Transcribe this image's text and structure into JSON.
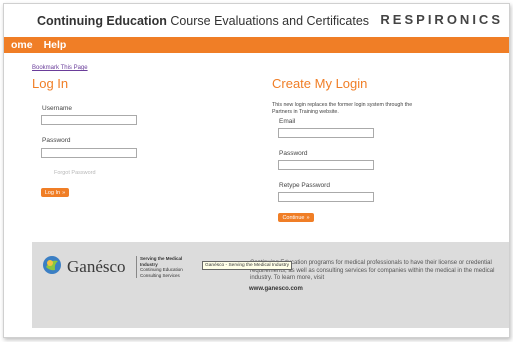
{
  "header": {
    "title_strong": "Continuing Education",
    "title_rest": " Course Evaluations and Certificates",
    "brand": "RESPIRONICS"
  },
  "nav": {
    "items": [
      "ome",
      "Help"
    ]
  },
  "bookmark_label": "Bookmark This Page",
  "login": {
    "heading": "Log In",
    "username_label": "Username",
    "username_value": "",
    "password_label": "Password",
    "password_value": "",
    "forgot_label": "Forgot Password",
    "button_label": "Log In"
  },
  "create": {
    "heading": "Create My Login",
    "description": "This new login replaces the former login system through the Partners in Training website.",
    "email_label": "Email",
    "email_value": "",
    "password_label": "Password",
    "password_value": "",
    "retype_label": "Retype Password",
    "retype_value": "",
    "button_label": "Continue"
  },
  "footer": {
    "logo_text": "Ganésco",
    "tag_title": "Serving the Medical Industry",
    "tag_line1": "Continuing Education",
    "tag_line2": "Consulting Services",
    "tooltip": "Ganésco - Serving the Medical Industry",
    "description": "Continuing Education programs for medical professionals to have their license or credential requirements, as well as consulting services for companies within the medical in the medical industry. To learn more, visit",
    "link": "www.ganesco.com"
  },
  "colors": {
    "accent": "#f07e26",
    "footer_bg": "#dcdcdc"
  }
}
